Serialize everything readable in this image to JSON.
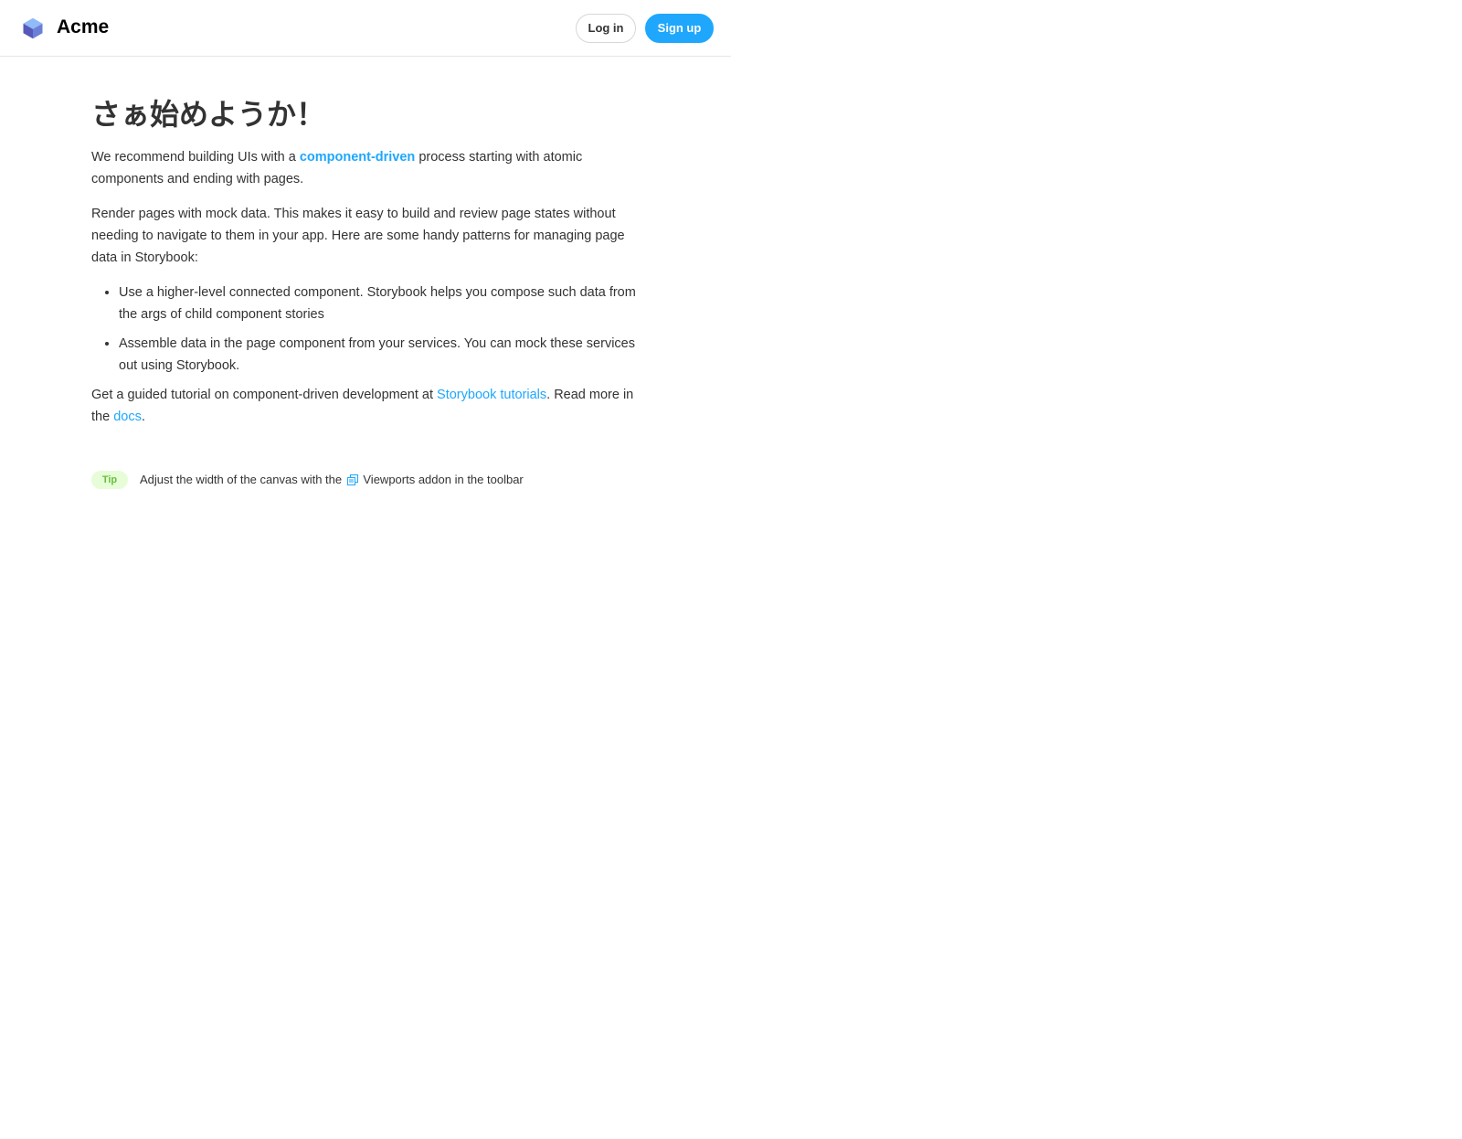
{
  "header": {
    "brand": "Acme",
    "login_label": "Log in",
    "signup_label": "Sign up"
  },
  "page": {
    "title": "さぁ始めようか！",
    "intro_before": "We recommend building UIs with a ",
    "intro_link": "component-driven",
    "intro_after": " process starting with atomic components and ending with pages.",
    "paragraph2": "Render pages with mock data. This makes it easy to build and review page states without needing to navigate to them in your app. Here are some handy patterns for managing page data in Storybook:",
    "bullets": [
      "Use a higher-level connected component. Storybook helps you compose such data from the args of child component stories",
      "Assemble data in the page component from your services. You can mock these services out using Storybook."
    ],
    "guide_before": "Get a guided tutorial on component-driven development at ",
    "guide_link": "Storybook tutorials",
    "guide_middle": ". Read more in the ",
    "docs_link": "docs",
    "guide_after": "."
  },
  "tip": {
    "badge": "Tip",
    "text_before": "Adjust the width of the canvas with the ",
    "icon": "viewports-icon",
    "text_after": "Viewports addon in the toolbar"
  },
  "colors": {
    "accent": "#1ea7fd",
    "tip_bg": "#e7fdd8",
    "tip_text": "#66bf3c",
    "logo_light": "#91baf8",
    "logo_mid": "#6b7fd8",
    "logo_dark": "#555ab9"
  }
}
